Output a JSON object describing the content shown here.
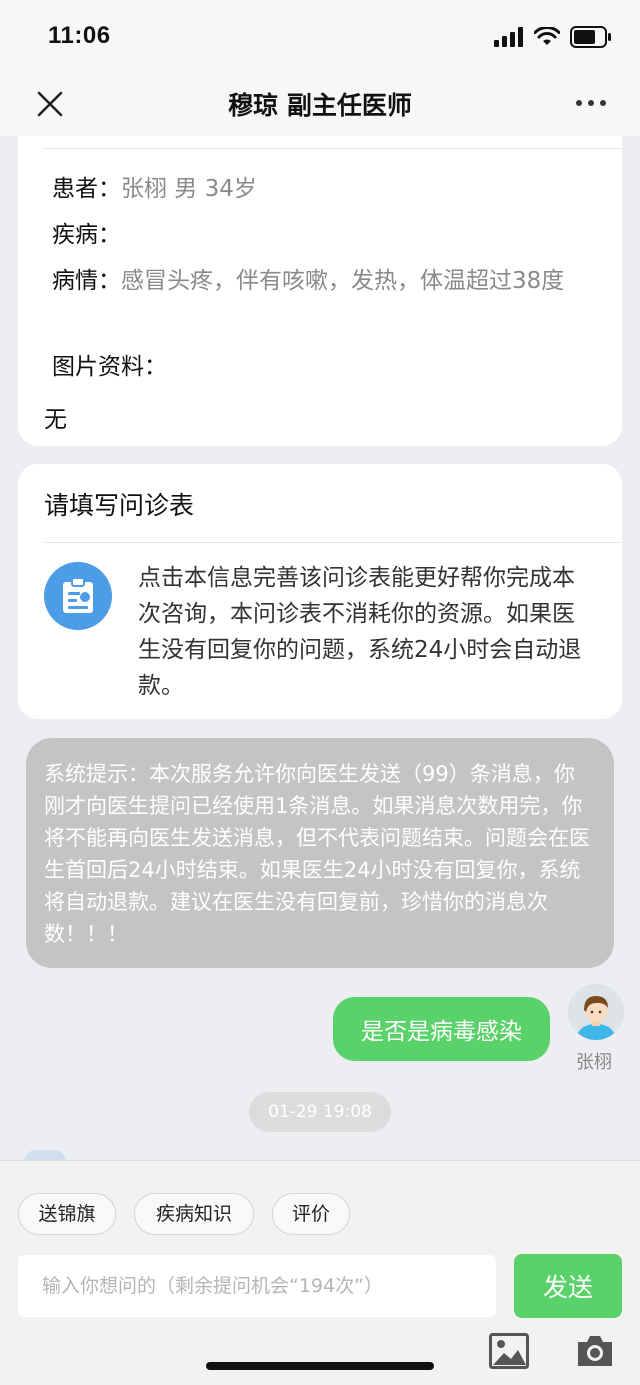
{
  "status_bar": {
    "time": "11:06"
  },
  "nav": {
    "title": "穆琼 副主任医师",
    "close_icon": "close-icon",
    "more_icon": "more-icon"
  },
  "patient": {
    "patient_label": "患者：",
    "patient_value": "张栩 男 34岁",
    "disease_label": "疾病：",
    "disease_value": "",
    "condition_label": "病情：",
    "condition_value": "感冒头疼，伴有咳嗽，发热，体温超过38度",
    "images_label": "图片资料：",
    "images_value": "无"
  },
  "questionnaire": {
    "title": "请填写问诊表",
    "icon": "clipboard-icon",
    "description": "点击本信息完善该问诊表能更好帮你完成本次咨询，本问诊表不消耗你的资源。如果医生没有回复你的问题，系统24小时会自动退款。"
  },
  "system_notice": {
    "text": "系统提示：本次服务允许你向医生发送（99）条消息，你刚才向医生提问已经使用1条消息。如果消息次数用完，你将不能再向医生发送消息，但不代表问题结束。问题会在医生首回后24小时结束。如果医生24小时没有回复你，系统将自动退款。建议在医生没有回复前，珍惜你的消息次数！！！"
  },
  "messages": [
    {
      "text": "是否是病毒感染",
      "sender": "张栩",
      "avatar": "user-avatar"
    }
  ],
  "timestamp": "01-29 19:08",
  "quick_actions": [
    "送锦旗",
    "疾病知识",
    "评价"
  ],
  "input": {
    "placeholder": "输入你想问的（剩余提问机会“194次”）",
    "value": ""
  },
  "send_label": "发送",
  "tools": [
    "image-icon",
    "camera-icon"
  ],
  "colors": {
    "accent_green": "#5ad26a",
    "icon_blue": "#4d9de6",
    "notice_gray": "#c4c4c4"
  }
}
